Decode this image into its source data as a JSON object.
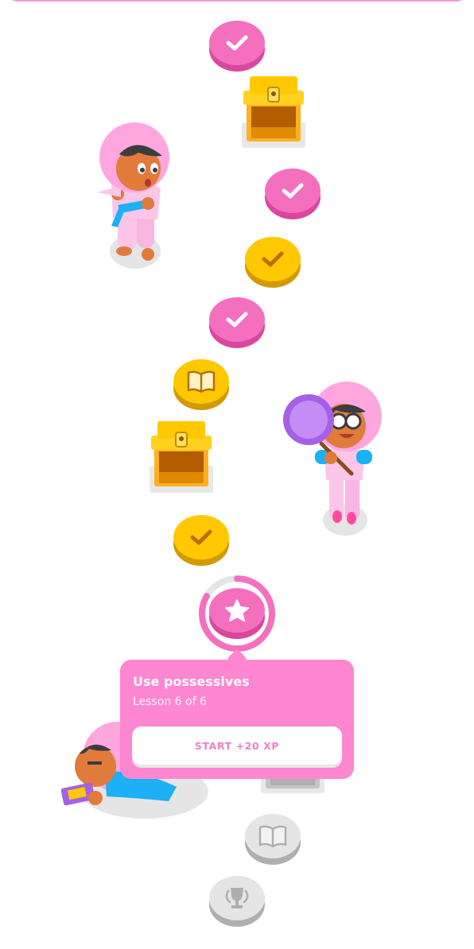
{
  "popup": {
    "title": "Use possessives",
    "subtitle": "Lesson 6 of 6",
    "button_label": "START +20 XP"
  },
  "colors": {
    "pink": "#f56fbf",
    "gold": "#ffc800",
    "locked": "#e5e5e5",
    "popup": "#ff86d0"
  },
  "path": {
    "nodes": [
      {
        "state": "completed",
        "icon": "check-icon"
      },
      {
        "state": "chest",
        "icon": "treasure-chest-icon"
      },
      {
        "state": "completed",
        "icon": "check-icon"
      },
      {
        "state": "legendary",
        "icon": "check-icon"
      },
      {
        "state": "completed",
        "icon": "check-icon"
      },
      {
        "state": "legendary",
        "icon": "book-icon"
      },
      {
        "state": "chest",
        "icon": "treasure-chest-icon"
      },
      {
        "state": "legendary",
        "icon": "check-icon"
      },
      {
        "state": "active",
        "icon": "star-icon"
      },
      {
        "state": "locked",
        "icon": "treasure-chest-icon"
      },
      {
        "state": "locked",
        "icon": "book-icon"
      },
      {
        "state": "locked",
        "icon": "trophy-icon"
      }
    ]
  }
}
